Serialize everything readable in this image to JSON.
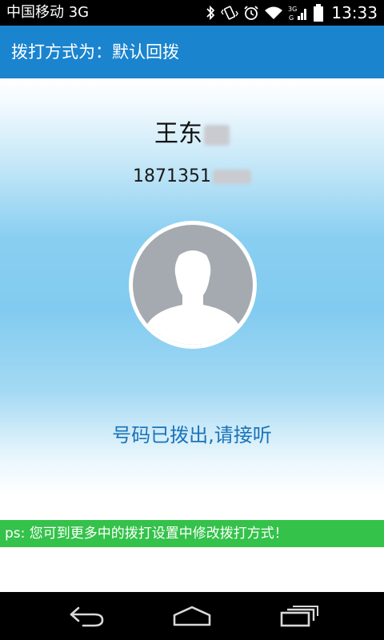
{
  "status_bar": {
    "carrier": "中国移动 3G",
    "network_label": "3G",
    "network_sub": "G",
    "time": "13:33",
    "icons": [
      "bluetooth-icon",
      "vibrate-icon",
      "alarm-icon",
      "wifi-icon",
      "signal-icon",
      "battery-icon"
    ]
  },
  "header": {
    "title": "拨打方式为：默认回拨"
  },
  "contact": {
    "name": "王东",
    "phone": "1871351"
  },
  "avatar": {
    "icon": "default-avatar-icon"
  },
  "call_status": "号码已拨出,请接听",
  "tip": "ps: 您可到更多中的拨打设置中修改拨打方式！",
  "nav": {
    "icons": [
      "back-icon",
      "home-icon",
      "recent-apps-icon"
    ]
  },
  "colors": {
    "header": "#1a84cf",
    "tip_bar": "#34c24a",
    "call_status_text": "#1a73b8",
    "status_bar": "#000000",
    "nav_bar": "#000000"
  }
}
